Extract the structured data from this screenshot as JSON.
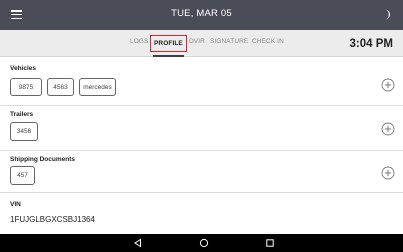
{
  "topbar": {
    "date": "TUE, MAR 05"
  },
  "tabs": [
    {
      "label": "LOGS",
      "active": false
    },
    {
      "label": "PROFILE",
      "active": true
    },
    {
      "label": "DVIR",
      "active": false
    },
    {
      "label": "SIGNATURE",
      "active": false
    },
    {
      "label": "CHECK IN",
      "active": false
    }
  ],
  "clock": "3:04 PM",
  "vehicles": {
    "title": "Vehicles",
    "items": [
      "9875",
      "4563",
      "mercedes"
    ]
  },
  "trailers": {
    "title": "Trailers",
    "items": [
      "3456"
    ]
  },
  "shipping": {
    "title": "Shipping Documents",
    "items": [
      "457"
    ]
  },
  "vin": {
    "title": "VIN",
    "value": "1FUJGLBGXCSBJ1364"
  },
  "colors": {
    "topbar": "#4a4d55",
    "active_tab_border": "#d9262c",
    "nav_bar": "#000000"
  }
}
